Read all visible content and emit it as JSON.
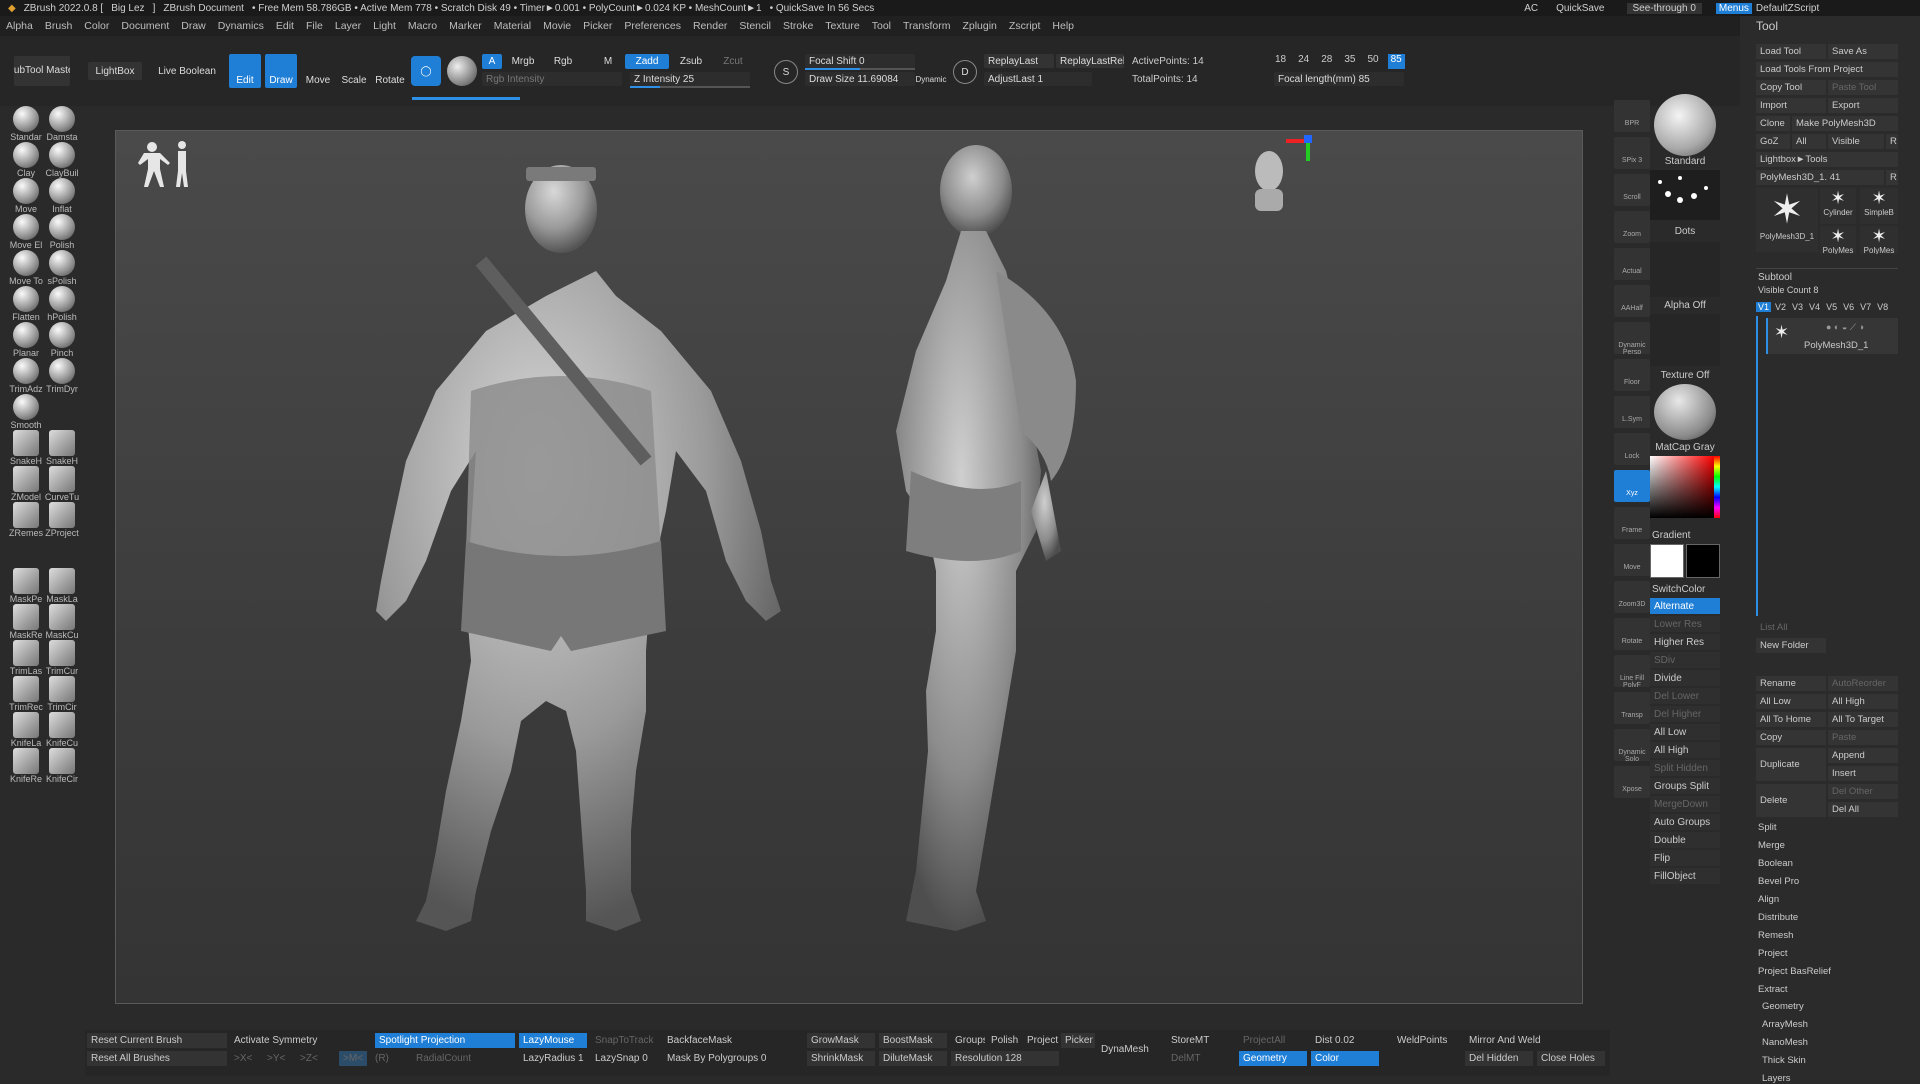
{
  "titlebar": {
    "app": "ZBrush 2022.0.8 [",
    "user": "Big Lez",
    "user_end": "]",
    "document": "ZBrush Document",
    "stats": "• Free Mem 58.786GB • Active Mem 778 • Scratch Disk 49 • Timer►0.001 • PolyCount►0.024 KP • MeshCount►1",
    "quicksave": "• QuickSave In 56 Secs",
    "ac": "AC",
    "quicksave_btn": "QuickSave",
    "seethrough": "See-through 0",
    "menus_btn": "Menus",
    "script": "DefaultZScript"
  },
  "menubar": [
    "Alpha",
    "Brush",
    "Color",
    "Document",
    "Draw",
    "Dynamics",
    "Edit",
    "File",
    "Layer",
    "Light",
    "Macro",
    "Marker",
    "Material",
    "Movie",
    "Picker",
    "Preferences",
    "Render",
    "Stencil",
    "Stroke",
    "Texture",
    "Tool",
    "Transform",
    "Zplugin",
    "Zscript",
    "Help"
  ],
  "top": {
    "subtool_master": "SubTool Master",
    "lightbox": "LightBox",
    "live_boolean": "Live Boolean",
    "edit": "Edit",
    "draw": "Draw",
    "move": "Move",
    "scale": "Scale",
    "rotate": "Rotate",
    "a": "A",
    "mrgb": "Mrgb",
    "rgb": "Rgb",
    "m": "M",
    "zadd": "Zadd",
    "zsub": "Zsub",
    "zcut": "Zcut",
    "rgb_intensity": "Rgb Intensity",
    "z_intensity": "Z Intensity 25",
    "focal_shift": "Focal Shift 0",
    "draw_size": "Draw Size 11.69084",
    "dynamic": "Dynamic",
    "replay_last": "ReplayLast",
    "replay_last_rel": "ReplayLastRel",
    "adjust_last": "AdjustLast 1",
    "active_points": "ActivePoints: 14",
    "total_points": "TotalPoints: 14",
    "fl": [
      "18",
      "24",
      "28",
      "35",
      "50",
      "85"
    ],
    "focal_length": "Focal length(mm) 85",
    "focal_shift_value": 0,
    "draw_size_value": 11.69084,
    "z_intensity_value": 25,
    "focal_length_value": 85
  },
  "brushes": [
    [
      "Standar",
      "Damsta"
    ],
    [
      "Clay",
      "ClayBuil"
    ],
    [
      "Move",
      "Inflat"
    ],
    [
      "Move El",
      "Polish"
    ],
    [
      "Move To",
      "sPolish"
    ],
    [
      "Flatten",
      "hPolish"
    ],
    [
      "Planar",
      "Pinch"
    ],
    [
      "TrimAdz",
      "TrimDyr"
    ],
    [
      "Smooth",
      ""
    ],
    [
      "SnakeH",
      "SnakeH"
    ],
    [
      "ZModel",
      "CurveTu"
    ],
    [
      "ZRemes",
      "ZProject"
    ],
    [
      "MaskPe",
      "MaskLa"
    ],
    [
      "MaskRe",
      "MaskCu"
    ],
    [
      "TrimLas",
      "TrimCur"
    ],
    [
      "TrimRec",
      "TrimCir"
    ],
    [
      "KnifeLa",
      "KnifeCu"
    ],
    [
      "KnifeRe",
      "KnifeCir"
    ]
  ],
  "dock": [
    [
      "BPR"
    ],
    [
      "SPix 3"
    ],
    [
      "Scroll"
    ],
    [
      "Zoom"
    ],
    [
      "Actual"
    ],
    [
      "AAHalf"
    ],
    [
      "Dynamic Persp"
    ],
    [
      "Floor"
    ],
    [
      "L.Sym"
    ],
    [
      "Lock"
    ],
    [
      "Xyz"
    ],
    [
      "Frame"
    ],
    [
      "Move"
    ],
    [
      "Zoom3D"
    ],
    [
      "Rotate"
    ],
    [
      "Line Fill PolyF"
    ],
    [
      "Transp"
    ],
    [
      "Dynamic Solo"
    ],
    [
      "Xpose"
    ]
  ],
  "dock_xyz": [
    "Xyz",
    "X",
    "Y",
    "Z"
  ],
  "matpanel": {
    "standard": "Standard",
    "dots": "Dots",
    "alpha_off": "Alpha Off",
    "texture_off": "Texture Off",
    "matcap": "MatCap Gray",
    "gradient": "Gradient",
    "switchcolor": "SwitchColor",
    "alternate": "Alternate",
    "primary_color": "#ffffff",
    "secondary_color": "#000000",
    "buttons": [
      "Lower Res",
      "Higher Res",
      "SDiv",
      "Divide",
      "Del Lower",
      "Del Higher",
      "All Low",
      "All High",
      "Split Hidden",
      "Groups Split",
      "MergeDown",
      "Auto Groups",
      "Double",
      "Flip",
      "FillObject"
    ]
  },
  "toolpanel": {
    "title": "Tool",
    "load_tool": "Load Tool",
    "save_as": "Save As",
    "load_from_project": "Load Tools From Project",
    "copy_tool": "Copy Tool",
    "paste_tool": "Paste Tool",
    "import": "Import",
    "export": "Export",
    "clone": "Clone",
    "make_polymesh": "Make PolyMesh3D",
    "goz": "GoZ",
    "all": "All",
    "visible": "Visible",
    "r": "R",
    "lightbox_tools": "Lightbox►Tools",
    "current_tool": "PolyMesh3D_1. 41",
    "thumbs": [
      "PolyMesh3D_1",
      "Cylinder",
      "SimpleB",
      "PolyMes",
      "PolyMes"
    ],
    "subtool": "Subtool",
    "visible_count": "Visible Count 8",
    "v": [
      "V1",
      "V2",
      "V3",
      "V4",
      "V5",
      "V6",
      "V7",
      "V8"
    ],
    "subtool_item": "PolyMesh3D_1",
    "list_all": "List All",
    "new_folder": "New Folder",
    "rename": "Rename",
    "autoreorder": "AutoReorder",
    "all_low": "All Low",
    "all_high": "All High",
    "all_to_home": "All To Home",
    "all_to_target": "All To Target",
    "copy": "Copy",
    "paste": "Paste",
    "duplicate": "Duplicate",
    "append": "Append",
    "insert": "Insert",
    "delete": "Delete",
    "del_other": "Del Other",
    "del_all": "Del All",
    "sections": [
      "Split",
      "Merge",
      "Boolean",
      "Bevel Pro",
      "Align",
      "Distribute",
      "Remesh",
      "Project",
      "Project BasRelief",
      "Extract"
    ],
    "sections2": [
      "Geometry",
      "ArrayMesh",
      "NanoMesh",
      "Thick Skin",
      "Layers"
    ]
  },
  "bottom": {
    "reset_current": "Reset Current Brush",
    "reset_all": "Reset All Brushes",
    "activate_symmetry": "Activate Symmetry",
    "x": ">X<",
    "y": ">Y<",
    "z": ">Z<",
    "m": ">M<",
    "r": "(R)",
    "radialcount": "RadialCount",
    "spotlight": "Spotlight Projection",
    "lazymouse": "LazyMouse",
    "lazyradius": "LazyRadius 1",
    "snaptotrack": "SnapToTrack",
    "lazysnap": "LazySnap 0",
    "backfacemask": "BackfaceMask",
    "mask_by_polygroups": "Mask By Polygroups 0",
    "growmask": "GrowMask",
    "shrinkmask": "ShrinkMask",
    "boostmask": "BoostMask",
    "dilutemask": "DiluteMask",
    "groups": "Groups",
    "polish": "Polish",
    "project": "Project",
    "picker": "Picker",
    "resolution": "Resolution 128",
    "dynamesh": "DynaMesh",
    "storemt": "StoreMT",
    "delmt": "DelMT",
    "projectall": "ProjectAll",
    "dist": "Dist 0.02",
    "geometry": "Geometry",
    "color": "Color",
    "weldpoints": "WeldPoints",
    "mirror_weld": "Mirror And Weld",
    "del_hidden": "Del Hidden",
    "close_holes": "Close Holes"
  }
}
